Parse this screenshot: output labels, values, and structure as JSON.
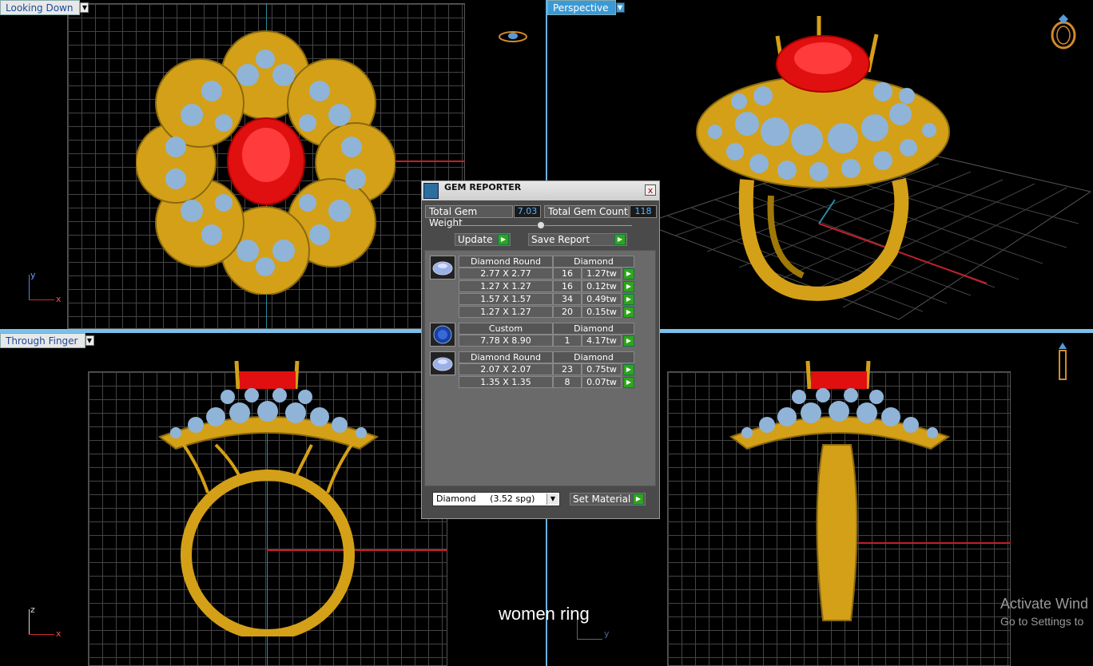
{
  "viewports": {
    "top_left": {
      "label": "Looking Down"
    },
    "top_right": {
      "label": "Perspective"
    },
    "bottom_left": {
      "label": "Through Finger"
    }
  },
  "axes": {
    "top_left": {
      "v": "y",
      "h": "x"
    },
    "bottom_left": {
      "v": "z",
      "h": "x"
    },
    "bottom_center": {
      "v": "y"
    }
  },
  "gem_reporter": {
    "title": "GEM REPORTER",
    "close": "x",
    "total_weight_label": "Total Gem Weight",
    "total_weight": "7.03",
    "total_count_label": "Total Gem Count",
    "total_count": "118",
    "update_label": "Update",
    "save_label": "Save Report",
    "groups": [
      {
        "shape": "Diamond Round",
        "material": "Diamond",
        "rows": [
          {
            "size": "2.77 X 2.77",
            "count": "16",
            "weight": "1.27tw"
          },
          {
            "size": "1.27 X 1.27",
            "count": "16",
            "weight": "0.12tw"
          },
          {
            "size": "1.57 X 1.57",
            "count": "34",
            "weight": "0.49tw"
          },
          {
            "size": "1.27 X 1.27",
            "count": "20",
            "weight": "0.15tw"
          }
        ]
      },
      {
        "shape": "Custom",
        "material": "Diamond",
        "rows": [
          {
            "size": "7.78 X 8.90",
            "count": "1",
            "weight": "4.17tw"
          }
        ]
      },
      {
        "shape": "Diamond Round",
        "material": "Diamond",
        "rows": [
          {
            "size": "2.07 X 2.07",
            "count": "23",
            "weight": "0.75tw"
          },
          {
            "size": "1.35 X 1.35",
            "count": "8",
            "weight": "0.07tw"
          }
        ]
      }
    ],
    "material_select": "Diamond     (3.52 spg)",
    "set_material_label": "Set Material"
  },
  "caption": "women ring",
  "watermark": {
    "line1": "Activate Wind",
    "line2": "Go to Settings to"
  },
  "colors": {
    "gold": "#d4a017",
    "ruby": "#e01010",
    "gem_blue": "#8fb4d8",
    "accent": "#3b9ad6",
    "go_green": "#2ea51c"
  }
}
